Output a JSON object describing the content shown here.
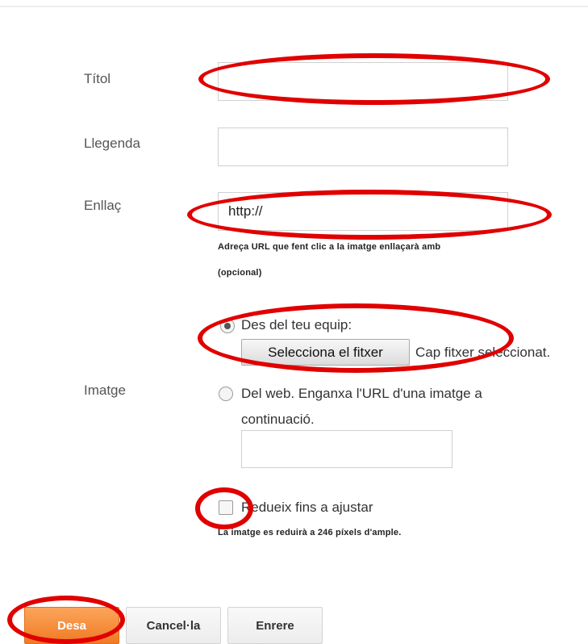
{
  "form": {
    "title_label": "Títol",
    "caption_label": "Llegenda",
    "link_label": "Enllaç",
    "link_value": "http://",
    "link_hint_line1": "Adreça URL que fent clic a la imatge enllaçarà amb",
    "link_hint_line2": "(opcional)",
    "image_label": "Imatge",
    "from_computer_label": "Des del teu equip:",
    "select_file_button": "Selecciona el fitxer",
    "no_file_text": "Cap fitxer seleccionat.",
    "from_web_line1": "Del web. Enganxa l'URL d'una imatge a",
    "from_web_line2": "continuació.",
    "shrink_label": "Redueix fins a ajustar",
    "shrink_hint": "La imatge es reduirà a 246 píxels d'ample."
  },
  "buttons": {
    "save": "Desa",
    "cancel": "Cancel·la",
    "back": "Enrere"
  },
  "colors": {
    "annotation": "#e00000",
    "save_button": "#f58b3a"
  },
  "state": {
    "selected_source": "Des del teu equip:",
    "shrink_checked": false
  }
}
